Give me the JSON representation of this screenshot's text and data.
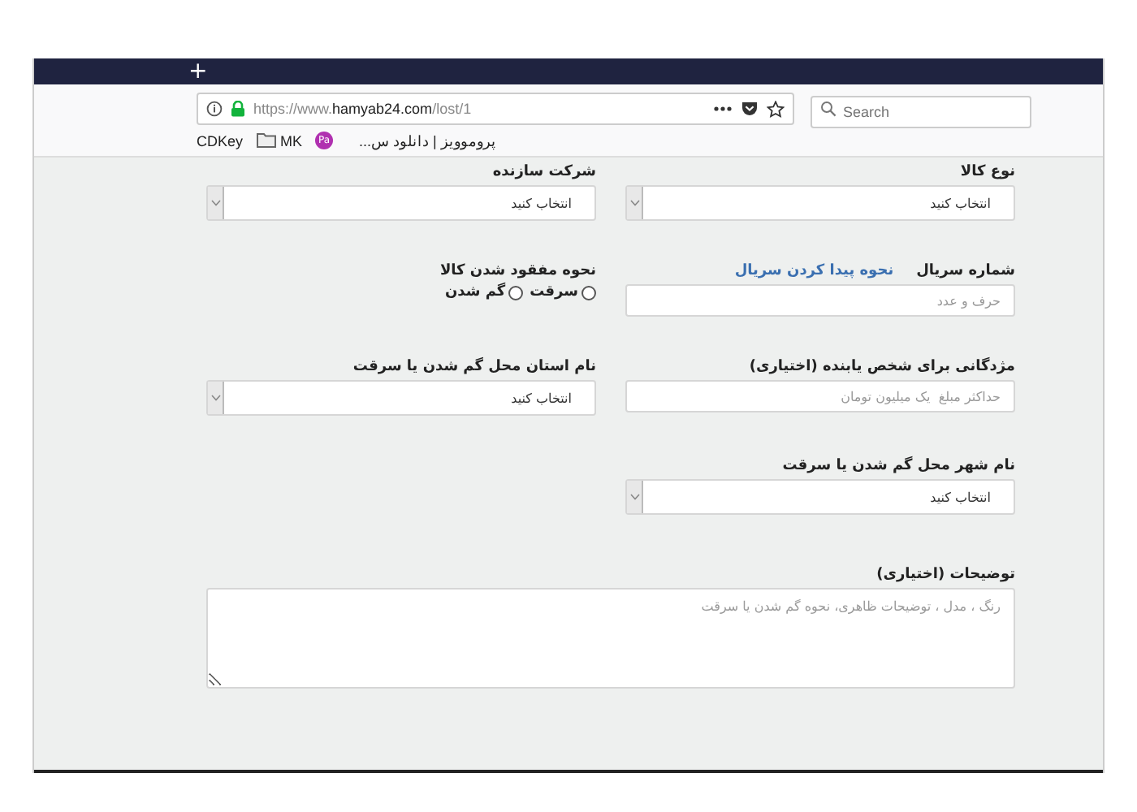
{
  "browser": {
    "new_tab": "+",
    "url": "https://www.**hamyab24.com**/lost/1",
    "search": {
      "placeholder": "Search"
    },
    "bookmarks": [
      {
        "kind": "plain",
        "label": "پروموویز | دانلود س..."
      },
      {
        "kind": "badge",
        "label": "Pa"
      },
      {
        "kind": "folder",
        "label": "MK"
      },
      {
        "kind": "plain",
        "label": "CDKey"
      }
    ]
  },
  "form": {
    "fields": [
      {
        "kind": "select",
        "label": "نوع کالا",
        "value": "انتخاب کنید"
      },
      {
        "kind": "select",
        "label": "شرکت سازنده",
        "value": "انتخاب کنید"
      },
      {
        "kind": "text",
        "label": "شماره سریال",
        "link": "نحوه پیدا کردن سریال",
        "placeholder": "حرف و عدد"
      },
      {
        "kind": "radio",
        "label": "نحوه مفقود شدن کالا",
        "options": [
          {
            "label": "سرقت",
            "selected": false
          },
          {
            "label": "گم شدن",
            "selected": false
          }
        ]
      },
      {
        "kind": "text",
        "label": "مژدگانی برای شخص یابنده (اختیاری)",
        "placeholder": "حداکثر مبلغ  یک میلیون تومان"
      },
      {
        "kind": "select",
        "label": "نام استان محل گم شدن یا سرقت",
        "value": "انتخاب کنید"
      },
      {
        "kind": "select",
        "label": "نام شهر محل گم شدن یا سرقت",
        "value": "انتخاب کنید"
      },
      {
        "kind": "textarea",
        "label": "توضیحات (اختیاری)",
        "placeholder": "رنگ ، مدل ، توضیحات ظاهری، نحوه گم شدن یا سرقت"
      }
    ]
  }
}
